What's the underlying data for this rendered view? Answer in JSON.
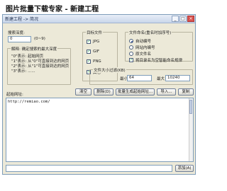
{
  "page_title": "图片批量下载专家 - 新建工程",
  "window": {
    "title": "新建工程 -> 简况"
  },
  "crawl_depth": {
    "label": "搜索深度:",
    "value": "0",
    "unit": "(0~9)"
  },
  "explain": {
    "title": "解释: 确定搜索的最大深度",
    "lines": [
      "\"0\"表示: 起始网页",
      "\"1\"表示: 从\"0\"可直接到达的网页",
      "\"2\"表示: 从\"1\"可直接到达的网页",
      "\"3\"表示: ......"
    ]
  },
  "target_files": {
    "title": "目标文件",
    "items": [
      {
        "label": "JPG",
        "checked": true
      },
      {
        "label": "GIF",
        "checked": true
      },
      {
        "label": "PNG",
        "checked": true
      },
      {
        "label": "其它",
        "checked": true
      }
    ]
  },
  "naming": {
    "title": "文件命名(重名时加序号)",
    "options": [
      {
        "label": "自动编号",
        "selected": true
      },
      {
        "label": "网站内编号",
        "selected": false
      },
      {
        "label": "原文件名",
        "selected": false
      }
    ],
    "extra_checkbox": {
      "label": "将目录名为空智能命名规律",
      "checked": true
    }
  },
  "size_filter": {
    "title": "文件大小过滤(KB)",
    "min_label": "最小",
    "min_value": "64",
    "max_label": "最大",
    "max_value": "10240"
  },
  "start_url": {
    "label": "起始网址:",
    "value": "http://remiao.com/"
  },
  "buttons": {
    "clear": "清空",
    "delete": "删除(D)",
    "batch_generate": "批量生成起始网址...",
    "import": "导入...",
    "copy": "复制",
    "add": "添加(A)"
  }
}
